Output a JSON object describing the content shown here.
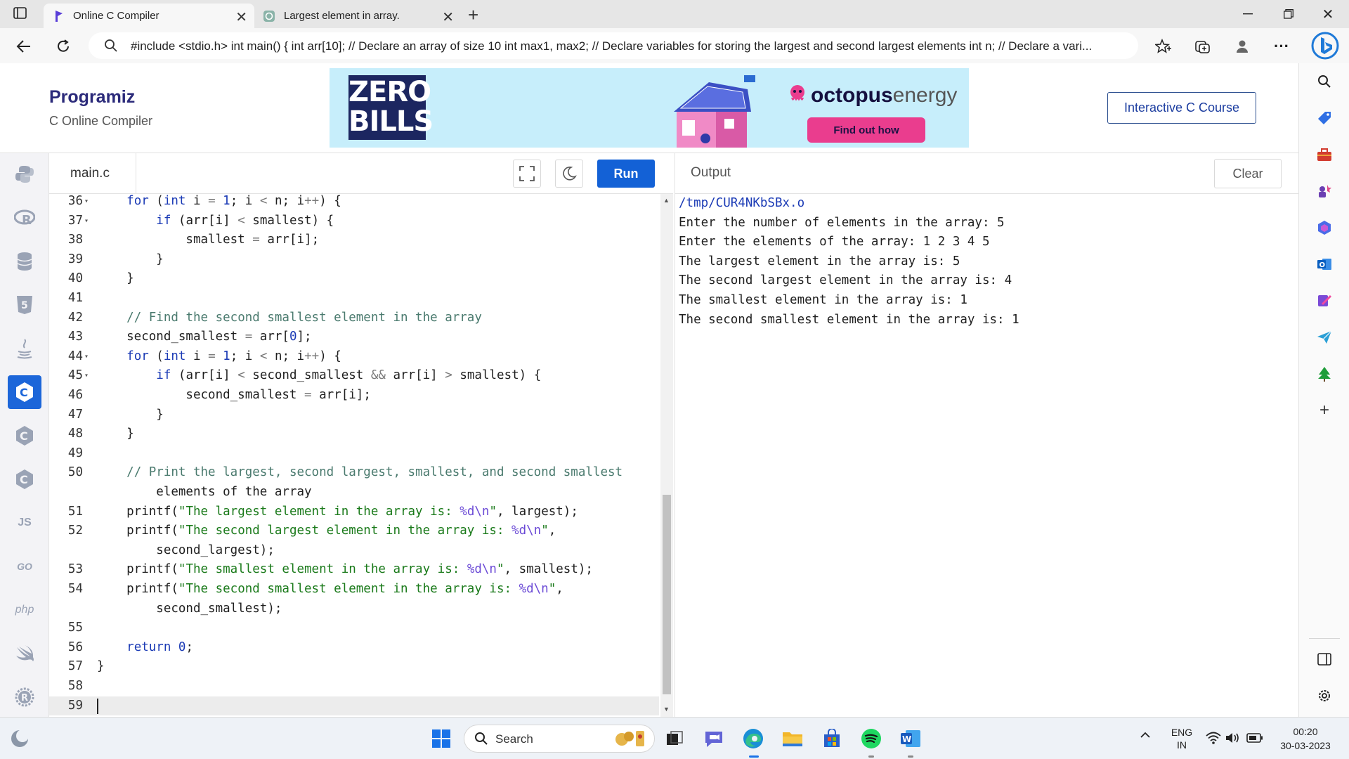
{
  "browser": {
    "tabs": [
      {
        "title": "Online C Compiler",
        "active": true,
        "icon": "programiz-logo-icon"
      },
      {
        "title": "Largest element in array.",
        "active": false,
        "icon": "chatgpt-icon"
      }
    ],
    "address": "#include <stdio.h> int main() { int arr[10]; // Declare an array of size 10 int max1, max2; // Declare variables for storing the largest and second largest elements int n; // Declare a vari..."
  },
  "header": {
    "brand": "Programiz",
    "subtitle": "C Online Compiler",
    "course_button": "Interactive C Course",
    "ad": {
      "headline_line1": "ZERO",
      "headline_line2": "BILLS",
      "brand_bold": "octopus",
      "brand_light": "energy",
      "cta": "Find out how"
    }
  },
  "languages": [
    "python-icon",
    "r-icon",
    "sql-icon",
    "html-icon",
    "java-icon",
    "c-icon",
    "cpp-icon",
    "csharp-icon",
    "JS",
    "GO",
    "php",
    "swift-icon",
    "rust-icon"
  ],
  "editor": {
    "file_name": "main.c",
    "run_label": "Run",
    "lines": [
      {
        "n": "36",
        "fold": true,
        "text": "    for (int i = 1; i < n; i++) {"
      },
      {
        "n": "37",
        "fold": true,
        "text": "        if (arr[i] < smallest) {"
      },
      {
        "n": "38",
        "fold": false,
        "text": "            smallest = arr[i];"
      },
      {
        "n": "39",
        "fold": false,
        "text": "        }"
      },
      {
        "n": "40",
        "fold": false,
        "text": "    }"
      },
      {
        "n": "41",
        "fold": false,
        "text": ""
      },
      {
        "n": "42",
        "fold": false,
        "text": "    // Find the second smallest element in the array"
      },
      {
        "n": "43",
        "fold": false,
        "text": "    second_smallest = arr[0];"
      },
      {
        "n": "44",
        "fold": true,
        "text": "    for (int i = 1; i < n; i++) {"
      },
      {
        "n": "45",
        "fold": true,
        "text": "        if (arr[i] < second_smallest && arr[i] > smallest) {"
      },
      {
        "n": "46",
        "fold": false,
        "text": "            second_smallest = arr[i];"
      },
      {
        "n": "47",
        "fold": false,
        "text": "        }"
      },
      {
        "n": "48",
        "fold": false,
        "text": "    }"
      },
      {
        "n": "49",
        "fold": false,
        "text": ""
      },
      {
        "n": "50",
        "fold": false,
        "text": "    // Print the largest, second largest, smallest, and second smallest"
      },
      {
        "n": "",
        "fold": false,
        "text": "        elements of the array"
      },
      {
        "n": "51",
        "fold": false,
        "text": "    printf(\"The largest element in the array is: %d\\n\", largest);"
      },
      {
        "n": "52",
        "fold": false,
        "text": "    printf(\"The second largest element in the array is: %d\\n\","
      },
      {
        "n": "",
        "fold": false,
        "text": "        second_largest);"
      },
      {
        "n": "53",
        "fold": false,
        "text": "    printf(\"The smallest element in the array is: %d\\n\", smallest);"
      },
      {
        "n": "54",
        "fold": false,
        "text": "    printf(\"The second smallest element in the array is: %d\\n\","
      },
      {
        "n": "",
        "fold": false,
        "text": "        second_smallest);"
      },
      {
        "n": "55",
        "fold": false,
        "text": ""
      },
      {
        "n": "56",
        "fold": false,
        "text": "    return 0;"
      },
      {
        "n": "57",
        "fold": false,
        "text": "}"
      },
      {
        "n": "58",
        "fold": false,
        "text": ""
      },
      {
        "n": "59",
        "fold": false,
        "text": ""
      }
    ]
  },
  "output": {
    "title": "Output",
    "clear_label": "Clear",
    "path": "/tmp/CUR4NKbSBx.o",
    "lines": [
      "Enter the number of elements in the array: 5",
      "Enter the elements of the array: 1 2 3 4 5",
      "The largest element in the array is: 5",
      "The second largest element in the array is: 4",
      "The smallest element in the array is: 1",
      "The second smallest element in the array is: 1"
    ]
  },
  "taskbar": {
    "search_label": "Search",
    "lang_line1": "ENG",
    "lang_line2": "IN",
    "time": "00:20",
    "date": "30-03-2023"
  },
  "colors": {
    "run_button": "#1361d6",
    "active_language": "#1c66d9",
    "brand": "#2b2a7a"
  }
}
